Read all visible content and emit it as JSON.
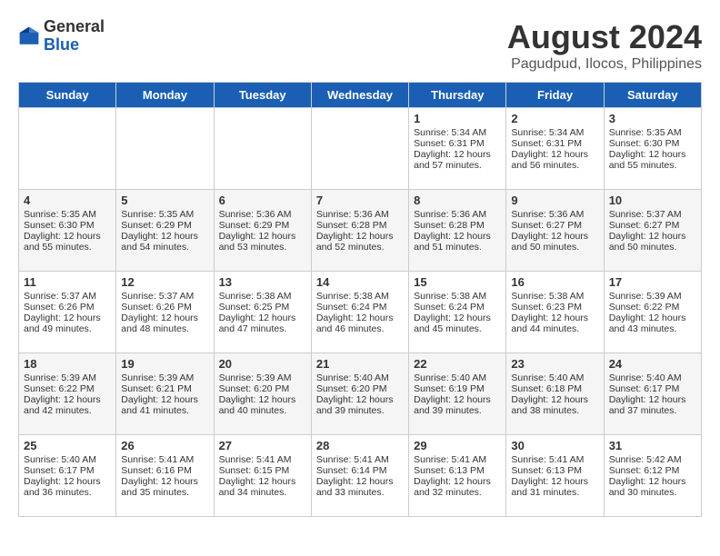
{
  "header": {
    "logo_general": "General",
    "logo_blue": "Blue",
    "title": "August 2024",
    "subtitle": "Pagudpud, Ilocos, Philippines"
  },
  "days_of_week": [
    "Sunday",
    "Monday",
    "Tuesday",
    "Wednesday",
    "Thursday",
    "Friday",
    "Saturday"
  ],
  "weeks": [
    [
      {
        "day": "",
        "content": ""
      },
      {
        "day": "",
        "content": ""
      },
      {
        "day": "",
        "content": ""
      },
      {
        "day": "",
        "content": ""
      },
      {
        "day": "1",
        "content": "Sunrise: 5:34 AM\nSunset: 6:31 PM\nDaylight: 12 hours\nand 57 minutes."
      },
      {
        "day": "2",
        "content": "Sunrise: 5:34 AM\nSunset: 6:31 PM\nDaylight: 12 hours\nand 56 minutes."
      },
      {
        "day": "3",
        "content": "Sunrise: 5:35 AM\nSunset: 6:30 PM\nDaylight: 12 hours\nand 55 minutes."
      }
    ],
    [
      {
        "day": "4",
        "content": "Sunrise: 5:35 AM\nSunset: 6:30 PM\nDaylight: 12 hours\nand 55 minutes."
      },
      {
        "day": "5",
        "content": "Sunrise: 5:35 AM\nSunset: 6:29 PM\nDaylight: 12 hours\nand 54 minutes."
      },
      {
        "day": "6",
        "content": "Sunrise: 5:36 AM\nSunset: 6:29 PM\nDaylight: 12 hours\nand 53 minutes."
      },
      {
        "day": "7",
        "content": "Sunrise: 5:36 AM\nSunset: 6:28 PM\nDaylight: 12 hours\nand 52 minutes."
      },
      {
        "day": "8",
        "content": "Sunrise: 5:36 AM\nSunset: 6:28 PM\nDaylight: 12 hours\nand 51 minutes."
      },
      {
        "day": "9",
        "content": "Sunrise: 5:36 AM\nSunset: 6:27 PM\nDaylight: 12 hours\nand 50 minutes."
      },
      {
        "day": "10",
        "content": "Sunrise: 5:37 AM\nSunset: 6:27 PM\nDaylight: 12 hours\nand 50 minutes."
      }
    ],
    [
      {
        "day": "11",
        "content": "Sunrise: 5:37 AM\nSunset: 6:26 PM\nDaylight: 12 hours\nand 49 minutes."
      },
      {
        "day": "12",
        "content": "Sunrise: 5:37 AM\nSunset: 6:26 PM\nDaylight: 12 hours\nand 48 minutes."
      },
      {
        "day": "13",
        "content": "Sunrise: 5:38 AM\nSunset: 6:25 PM\nDaylight: 12 hours\nand 47 minutes."
      },
      {
        "day": "14",
        "content": "Sunrise: 5:38 AM\nSunset: 6:24 PM\nDaylight: 12 hours\nand 46 minutes."
      },
      {
        "day": "15",
        "content": "Sunrise: 5:38 AM\nSunset: 6:24 PM\nDaylight: 12 hours\nand 45 minutes."
      },
      {
        "day": "16",
        "content": "Sunrise: 5:38 AM\nSunset: 6:23 PM\nDaylight: 12 hours\nand 44 minutes."
      },
      {
        "day": "17",
        "content": "Sunrise: 5:39 AM\nSunset: 6:22 PM\nDaylight: 12 hours\nand 43 minutes."
      }
    ],
    [
      {
        "day": "18",
        "content": "Sunrise: 5:39 AM\nSunset: 6:22 PM\nDaylight: 12 hours\nand 42 minutes."
      },
      {
        "day": "19",
        "content": "Sunrise: 5:39 AM\nSunset: 6:21 PM\nDaylight: 12 hours\nand 41 minutes."
      },
      {
        "day": "20",
        "content": "Sunrise: 5:39 AM\nSunset: 6:20 PM\nDaylight: 12 hours\nand 40 minutes."
      },
      {
        "day": "21",
        "content": "Sunrise: 5:40 AM\nSunset: 6:20 PM\nDaylight: 12 hours\nand 39 minutes."
      },
      {
        "day": "22",
        "content": "Sunrise: 5:40 AM\nSunset: 6:19 PM\nDaylight: 12 hours\nand 39 minutes."
      },
      {
        "day": "23",
        "content": "Sunrise: 5:40 AM\nSunset: 6:18 PM\nDaylight: 12 hours\nand 38 minutes."
      },
      {
        "day": "24",
        "content": "Sunrise: 5:40 AM\nSunset: 6:17 PM\nDaylight: 12 hours\nand 37 minutes."
      }
    ],
    [
      {
        "day": "25",
        "content": "Sunrise: 5:40 AM\nSunset: 6:17 PM\nDaylight: 12 hours\nand 36 minutes."
      },
      {
        "day": "26",
        "content": "Sunrise: 5:41 AM\nSunset: 6:16 PM\nDaylight: 12 hours\nand 35 minutes."
      },
      {
        "day": "27",
        "content": "Sunrise: 5:41 AM\nSunset: 6:15 PM\nDaylight: 12 hours\nand 34 minutes."
      },
      {
        "day": "28",
        "content": "Sunrise: 5:41 AM\nSunset: 6:14 PM\nDaylight: 12 hours\nand 33 minutes."
      },
      {
        "day": "29",
        "content": "Sunrise: 5:41 AM\nSunset: 6:13 PM\nDaylight: 12 hours\nand 32 minutes."
      },
      {
        "day": "30",
        "content": "Sunrise: 5:41 AM\nSunset: 6:13 PM\nDaylight: 12 hours\nand 31 minutes."
      },
      {
        "day": "31",
        "content": "Sunrise: 5:42 AM\nSunset: 6:12 PM\nDaylight: 12 hours\nand 30 minutes."
      }
    ]
  ]
}
